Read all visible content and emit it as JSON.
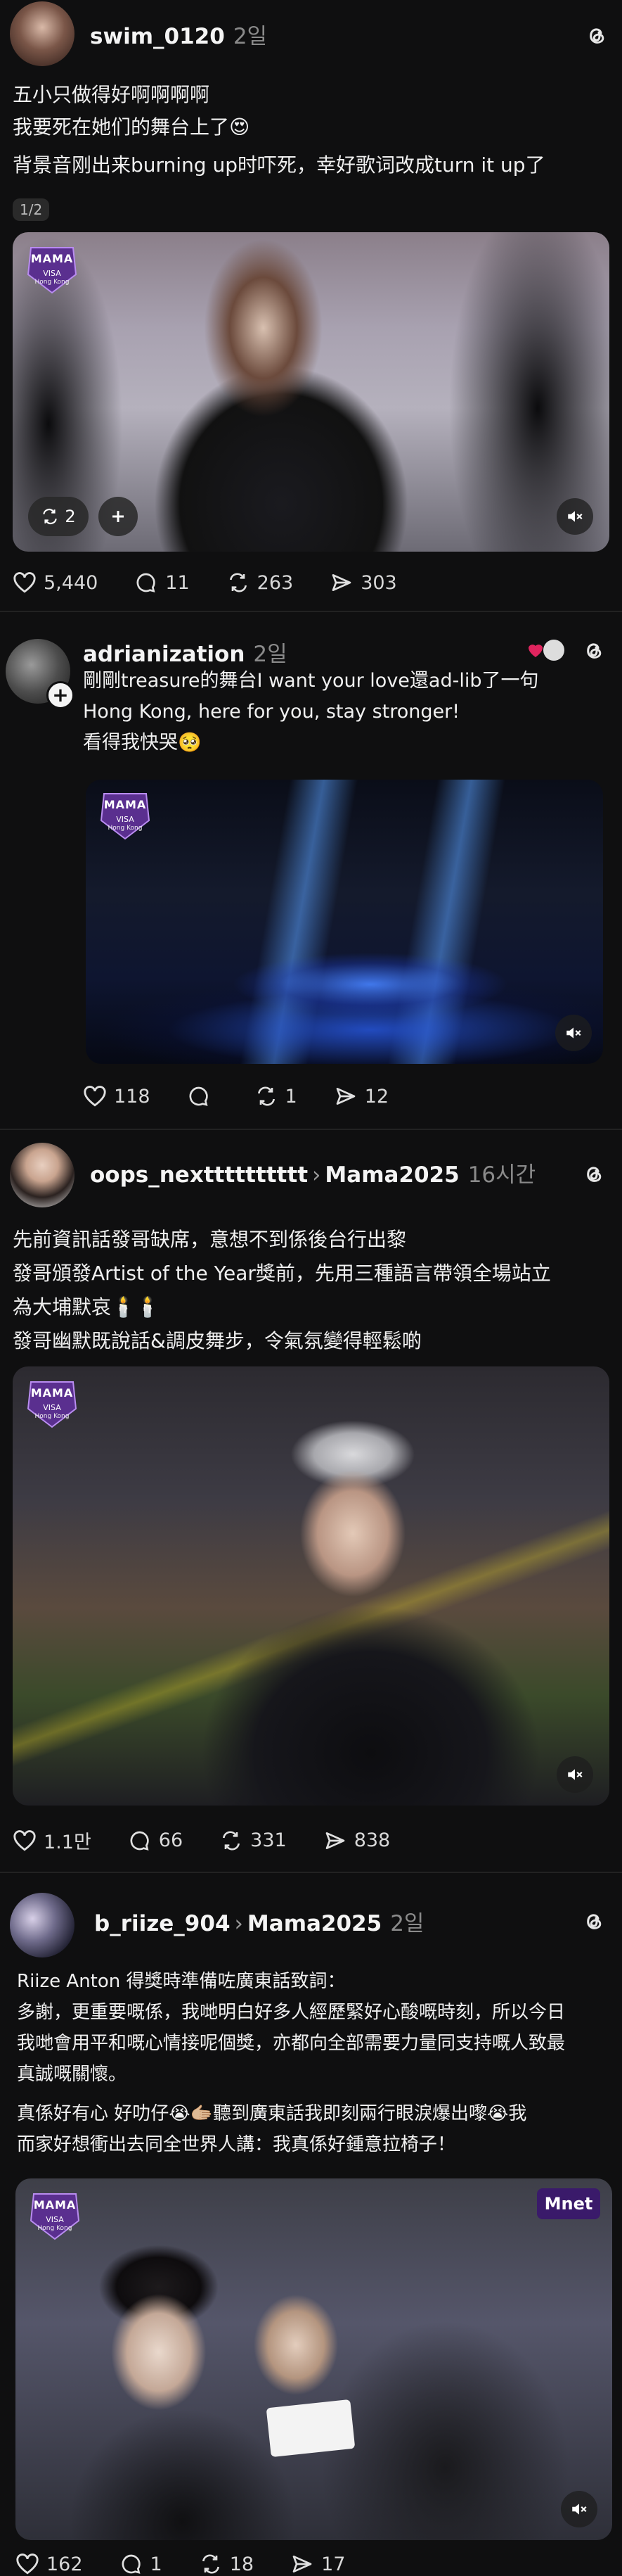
{
  "posts": [
    {
      "username": "swim_0120",
      "time": "2일",
      "lines": [
        "五小只做得好啊啊啊啊",
        "我要死在她们的舞台上了😍",
        "背景音刚出来burning up时吓死，幸好歌词改成turn it up了"
      ],
      "pager": "1/2",
      "media_overlay": {
        "repost_count": "2"
      },
      "stats": {
        "likes": "5,440",
        "comments": "11",
        "reposts": "263",
        "shares": "303"
      }
    },
    {
      "username": "adrianization",
      "time": "2일",
      "lines": [
        "剛剛treasure的舞台I want your love還ad-lib了一句",
        "Hong Kong, here for you, stay stronger!",
        "看得我快哭🥺"
      ],
      "stats": {
        "likes": "118",
        "comments": "",
        "reposts": "1",
        "shares": "12"
      }
    },
    {
      "username": "oops_nextttttttttt",
      "topic": "Mama2025",
      "time": "16시간",
      "lines": [
        "先前資訊話發哥缺席，意想不到係後台行出黎",
        "發哥頒發Artist of the Year獎前，先用三種語言帶領全場站立",
        "為大埔默哀🕯️🕯️",
        "發哥幽默既說話&調皮舞步，令氣氛變得輕鬆啲"
      ],
      "stats": {
        "likes": "1.1만",
        "comments": "66",
        "reposts": "331",
        "shares": "838"
      }
    },
    {
      "username": "b_riize_904",
      "topic": "Mama2025",
      "time": "2일",
      "lines": [
        "Riize Anton 得獎時準備咗廣東話致詞：",
        "多謝，更重要嘅係，我哋明白好多人經歷緊好心酸嘅時刻，所以今日",
        "我哋會用平和嘅心情接呢個獎，亦都向全部需要力量同支持嘅人致最",
        "真誠嘅關懷。",
        "真係好有心 好叻仔😭🫱🏼聽到廣東話我即刻兩行眼淚爆出嚟😭我",
        "而家好想衝出去同全世界人講：我真係好鍾意拉椅子！"
      ],
      "stats": {
        "likes": "162",
        "comments": "1",
        "reposts": "18",
        "shares": "17"
      }
    }
  ],
  "mama_badge": {
    "title": "MAMA",
    "line1": "AWARDS 2025",
    "line2": "VISA",
    "line3": "Support",
    "line4": "Hong Kong"
  },
  "mnet_logo": "Mnet",
  "colors": {
    "bg": "#0f0f10",
    "text": "#f0f0f0",
    "muted": "#8a8a8a",
    "like_red": "#e0245e"
  }
}
